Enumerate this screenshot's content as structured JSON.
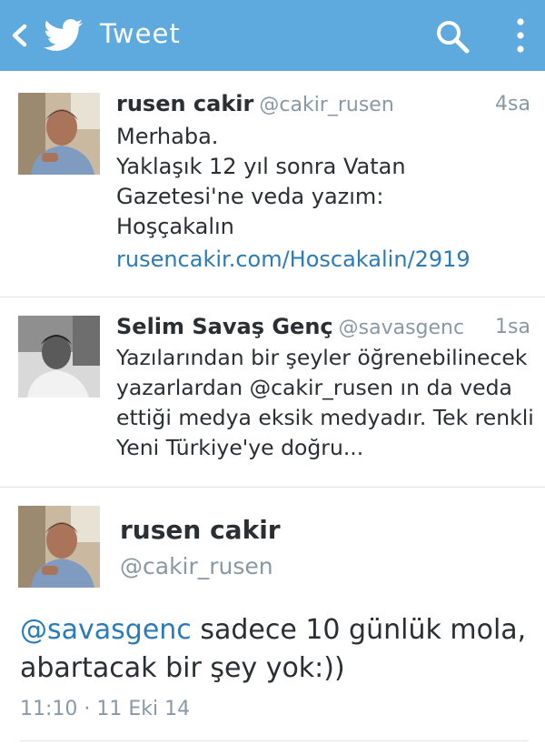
{
  "header": {
    "title": "Tweet",
    "back_icon": "back-chevron-icon",
    "logo_icon": "twitter-bird-icon",
    "search_icon": "search-icon",
    "overflow_icon": "overflow-menu-icon",
    "bg_color": "#5ea9dd"
  },
  "tweets": [
    {
      "name": "rusen cakir",
      "handle": "@cakir_rusen",
      "time": "4sa",
      "text": "Merhaba.\nYaklaşık 12 yıl sonra Vatan\nGazetesi'ne veda yazım:\nHoşçakalın",
      "link": "rusencakir.com/Hoscakalin/2919"
    },
    {
      "name": "Selim Savaş Genç",
      "handle": "@savasgenc",
      "time": "1sa",
      "text": "Yazılarından bir şeyler öğrenebilinecek\nyazarlardan @cakir_rusen ın da veda\nettiği medya eksik medyadır. Tek renkli\nYeni Türkiye'ye doğru..."
    }
  ],
  "detail": {
    "name": "rusen cakir",
    "handle": "@cakir_rusen",
    "mention": "@savasgenc",
    "text_line1": " sadece 10 günlük mola,",
    "text_line2": "abartacak bir şey yok:))",
    "timestamp": "11:10 · 11 Eki 14"
  },
  "colors": {
    "link": "#2b7bb9",
    "muted": "#8899a6",
    "text": "#292f33"
  }
}
